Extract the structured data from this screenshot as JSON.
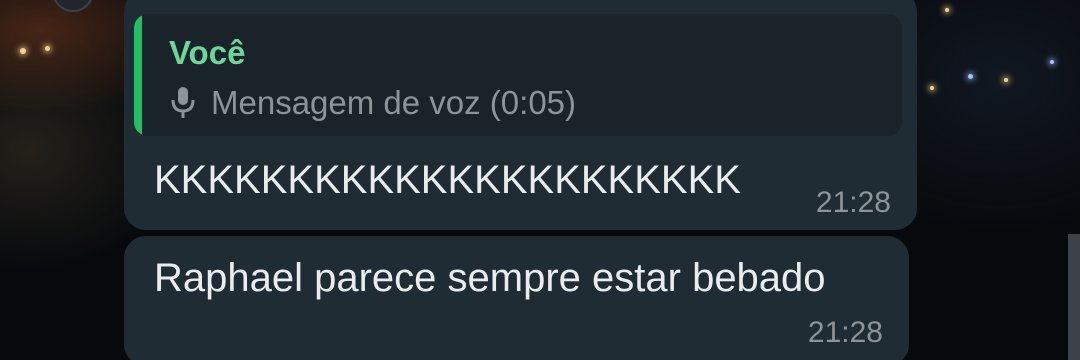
{
  "messages": [
    {
      "quoted": {
        "author": "Você",
        "icon": "mic-icon",
        "text": "Mensagem de voz (0:05)"
      },
      "text": "KKKKKKKKKKKKKKKKKKKKKK",
      "time": "21:28"
    },
    {
      "text": "Raphael parece sempre estar bebado",
      "time": "21:28"
    }
  ],
  "colors": {
    "bubble": "#202c33",
    "quote_bar": "#21c063",
    "quote_author": "#6bd89a",
    "meta_text": "#8b9599"
  }
}
